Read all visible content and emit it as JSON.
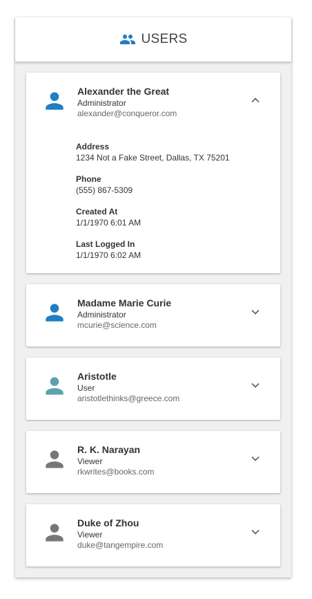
{
  "header": {
    "title": "USERS",
    "icon": "group-icon",
    "icon_color": "#1f7ec4"
  },
  "users": [
    {
      "name": "Alexander the Great",
      "role": "Administrator",
      "email": "alexander@conqueror.com",
      "avatar_color": "#1f7ec4",
      "expanded": true,
      "details": [
        {
          "label": "Address",
          "value": "1234 Not a Fake Street, Dallas, TX 75201"
        },
        {
          "label": "Phone",
          "value": "(555) 867-5309"
        },
        {
          "label": "Created At",
          "value": "1/1/1970 6:01 AM"
        },
        {
          "label": "Last Logged In",
          "value": "1/1/1970 6:02 AM"
        }
      ]
    },
    {
      "name": "Madame Marie Curie",
      "role": "Administrator",
      "email": "mcurie@science.com",
      "avatar_color": "#1f7ec4",
      "expanded": false
    },
    {
      "name": "Aristotle",
      "role": "User",
      "email": "aristotlethinks@greece.com",
      "avatar_color": "#5ba3ab",
      "expanded": false
    },
    {
      "name": "R. K. Narayan",
      "role": "Viewer",
      "email": "rkwrites@books.com",
      "avatar_color": "#777777",
      "expanded": false
    },
    {
      "name": "Duke of Zhou",
      "role": "Viewer",
      "email": "duke@tangempire.com",
      "avatar_color": "#777777",
      "expanded": false
    }
  ]
}
